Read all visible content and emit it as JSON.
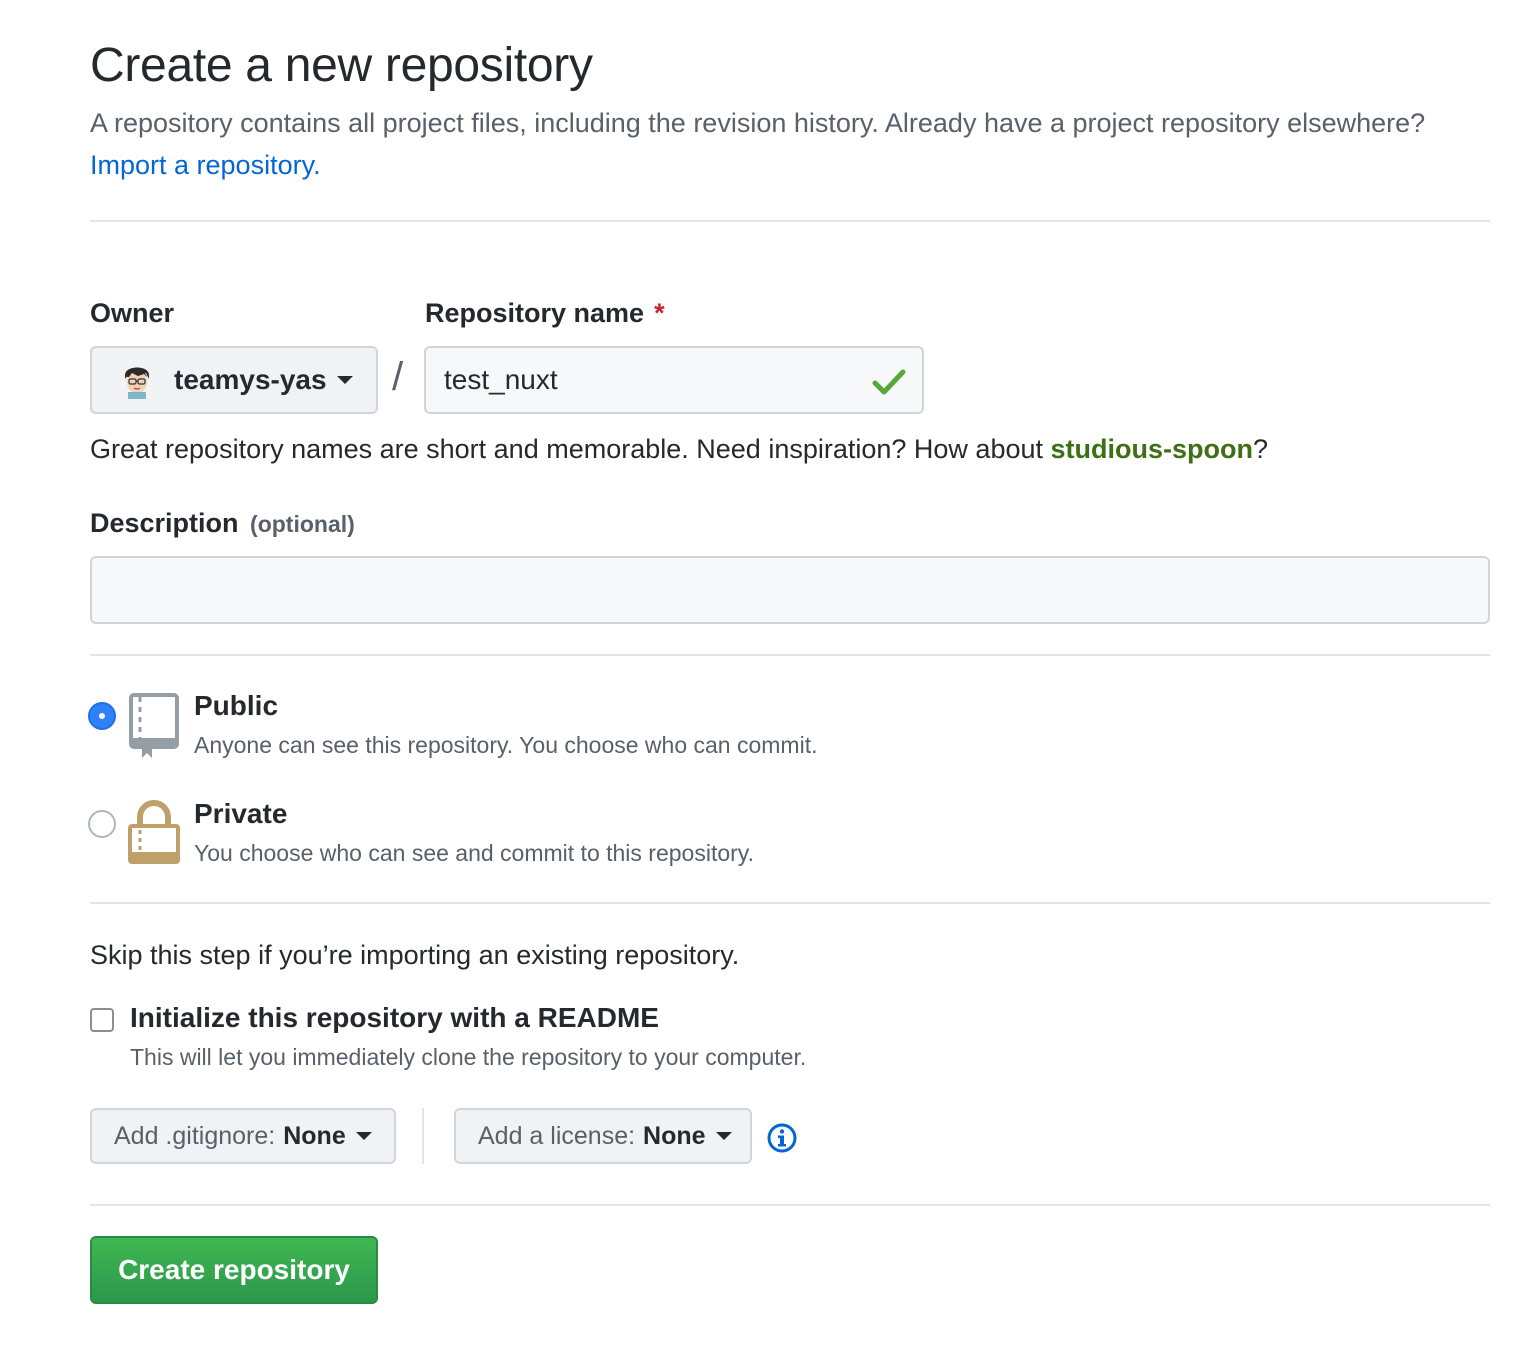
{
  "header": {
    "title": "Create a new repository",
    "intro_text": "A repository contains all project files, including the revision history. Already have a project repository elsewhere?",
    "import_link": "Import a repository."
  },
  "owner": {
    "label": "Owner",
    "value": "teamys-yas"
  },
  "repo_name": {
    "label": "Repository name",
    "required_mark": "*",
    "value": "test_nuxt",
    "separator": "/"
  },
  "name_hint": {
    "text": "Great repository names are short and memorable. Need inspiration? How about",
    "suggestion": "studious-spoon",
    "suffix": "?"
  },
  "description": {
    "label": "Description",
    "optional_text": "(optional)",
    "value": ""
  },
  "visibility": {
    "public": {
      "title": "Public",
      "desc": "Anyone can see this repository. You choose who can commit.",
      "selected": true
    },
    "private": {
      "title": "Private",
      "desc": "You choose who can see and commit to this repository.",
      "selected": false
    }
  },
  "init": {
    "skip_text": "Skip this step if you’re importing an existing repository.",
    "readme_label": "Initialize this repository with a README",
    "readme_desc": "This will let you immediately clone the repository to your computer.",
    "readme_checked": false
  },
  "gitignore": {
    "label": "Add .gitignore:",
    "value": "None"
  },
  "license": {
    "label": "Add a license:",
    "value": "None"
  },
  "submit": {
    "label": "Create repository"
  },
  "colors": {
    "link": "#0366d6",
    "suggestion": "#3e6f14",
    "primary_button": "#2ea44f",
    "check": "#5aa63b",
    "required": "#cb2431",
    "radio_selected": "#2f81f7"
  },
  "icons": [
    "avatar",
    "caret-down-icon",
    "check-icon",
    "repo-book-icon",
    "lock-icon",
    "info-icon"
  ]
}
